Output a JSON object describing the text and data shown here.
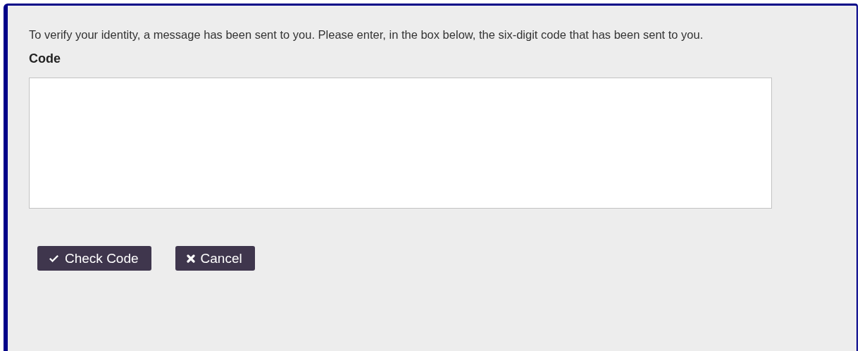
{
  "message": "To verify your identity, a message has been sent to you. Please enter, in the box below, the six-digit code that has been sent to you.",
  "code_field": {
    "label": "Code"
  },
  "buttons": [
    {
      "kind": "check",
      "label": "Check Code"
    },
    {
      "kind": "cancel",
      "label": "Cancel"
    }
  ]
}
